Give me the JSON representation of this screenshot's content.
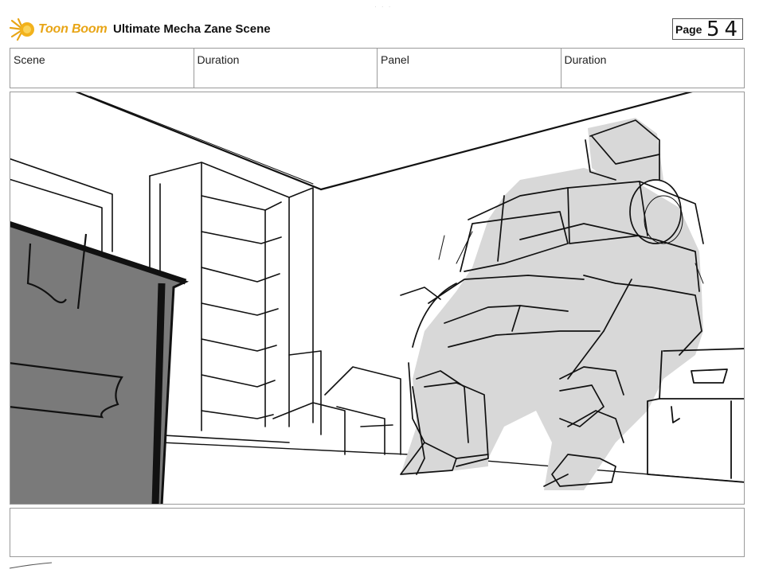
{
  "header": {
    "brand": "Toon Boom",
    "title": "Ultimate Mecha Zane Scene",
    "page_label": "Page",
    "page_number": "54"
  },
  "info_row": {
    "scene_label": "Scene",
    "duration_label_1": "Duration",
    "panel_label": "Panel",
    "duration_label_2": "Duration"
  },
  "colors": {
    "brand": "#e8a516",
    "border": "#9a9a9a",
    "sketch_fill": "#d8d8d8",
    "dark_fill": "#7a7a7a"
  },
  "icons": {
    "logo": "starburst-icon"
  }
}
